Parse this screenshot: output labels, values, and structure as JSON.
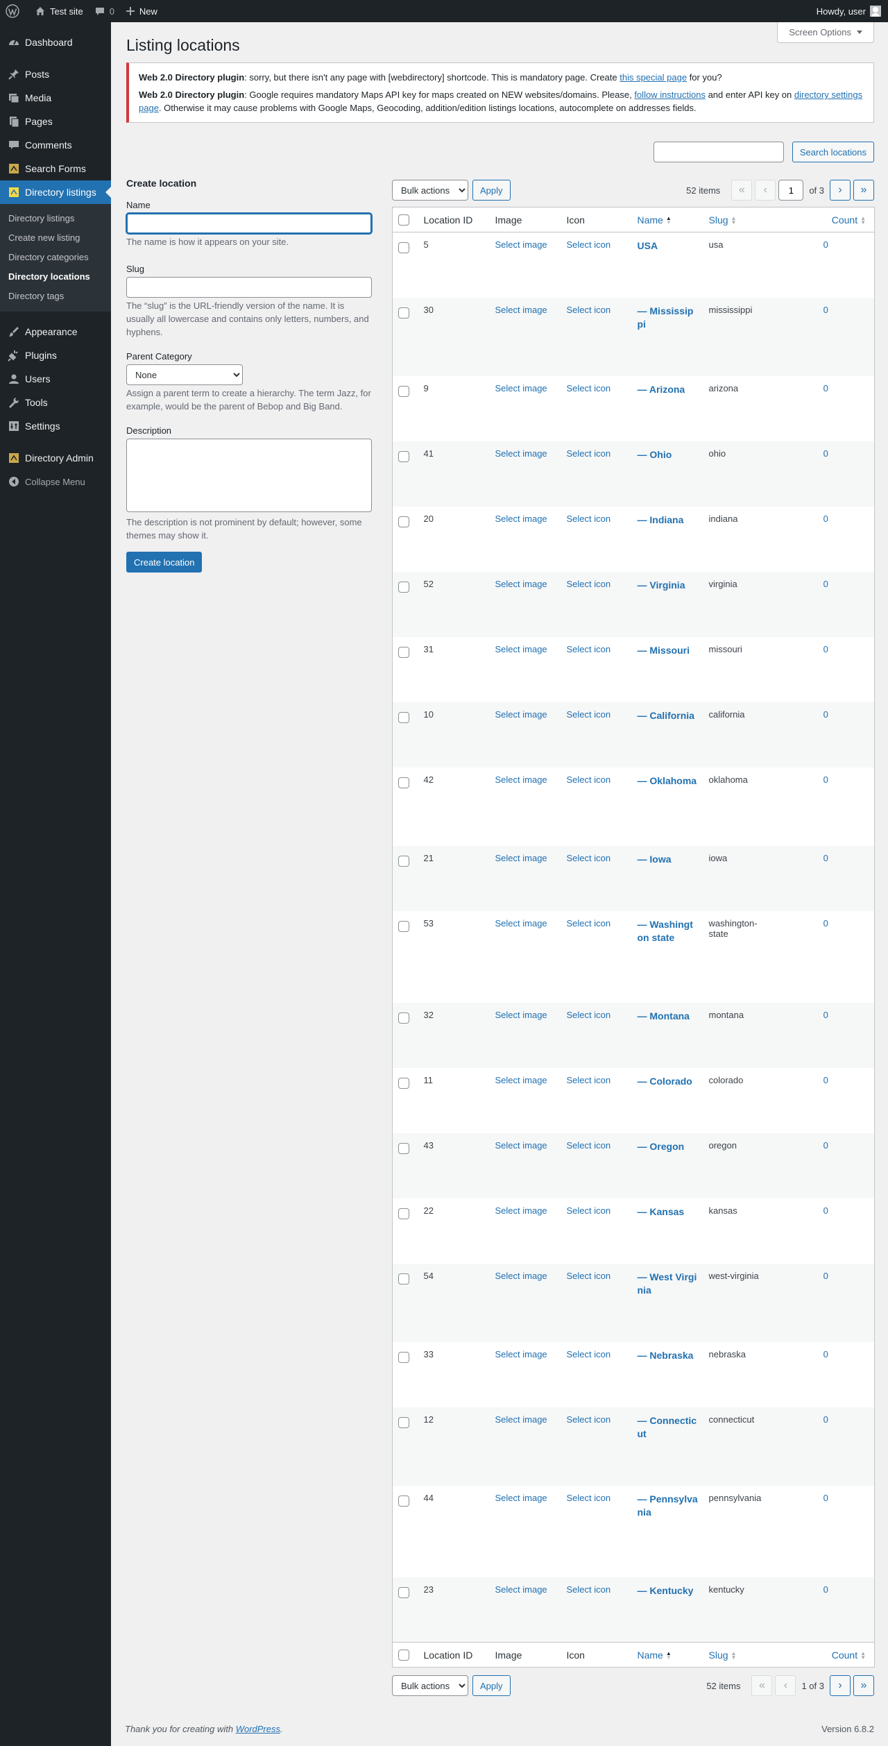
{
  "adminbar": {
    "site_name": "Test site",
    "comments_count": "0",
    "new_label": "New",
    "howdy": "Howdy, user"
  },
  "sidebar": {
    "items": [
      {
        "label": "Dashboard",
        "icon": "dashboard-icon"
      },
      {
        "label": "Posts",
        "icon": "pin-icon"
      },
      {
        "label": "Media",
        "icon": "media-icon"
      },
      {
        "label": "Pages",
        "icon": "pages-icon"
      },
      {
        "label": "Comments",
        "icon": "comment-icon"
      },
      {
        "label": "Search Forms",
        "icon": "plugin-box-icon"
      },
      {
        "label": "Directory listings",
        "icon": "plugin-box-icon"
      }
    ],
    "submenu": [
      "Directory listings",
      "Create new listing",
      "Directory categories",
      "Directory locations",
      "Directory tags"
    ],
    "items2": [
      {
        "label": "Appearance",
        "icon": "brush-icon"
      },
      {
        "label": "Plugins",
        "icon": "plug-icon"
      },
      {
        "label": "Users",
        "icon": "users-icon"
      },
      {
        "label": "Tools",
        "icon": "wrench-icon"
      },
      {
        "label": "Settings",
        "icon": "settings-icon"
      }
    ],
    "directory_admin": "Directory Admin",
    "collapse": "Collapse Menu"
  },
  "page": {
    "title": "Listing locations",
    "screen_options": "Screen Options"
  },
  "notice": {
    "plugin": "Web 2.0 Directory plugin",
    "msg1_a": ": sorry, but there isn't any page with [webdirectory] shortcode. This is mandatory page. Create ",
    "msg1_link": "this special page",
    "msg1_b": " for you?",
    "msg2_a": ": Google requires mandatory Maps API key for maps created on NEW websites/domains. Please, ",
    "msg2_link1": "follow instructions",
    "msg2_b": " and enter API key on ",
    "msg2_link2": "directory settings page",
    "msg2_c": ". Otherwise it may cause problems with Google Maps, Geocoding, addition/edition listings locations, autocomplete on addresses fields."
  },
  "search": {
    "button": "Search locations",
    "value": ""
  },
  "form": {
    "heading": "Create location",
    "name_label": "Name",
    "name_desc": "The name is how it appears on your site.",
    "slug_label": "Slug",
    "slug_desc": "The “slug” is the URL-friendly version of the name. It is usually all lowercase and contains only letters, numbers, and hyphens.",
    "parent_label": "Parent Category",
    "parent_value": "None",
    "parent_desc": "Assign a parent term to create a hierarchy. The term Jazz, for example, would be the parent of Bebop and Big Band.",
    "description_label": "Description",
    "description_desc": "The description is not prominent by default; however, some themes may show it.",
    "submit": "Create location"
  },
  "tablenav": {
    "bulk_actions": "Bulk actions",
    "apply": "Apply",
    "items": "52 items",
    "current_page": "1",
    "of_pages": "of 3",
    "bottom_page_text": "1 of 3"
  },
  "table": {
    "columns": [
      "Location ID",
      "Image",
      "Icon",
      "Name",
      "Slug",
      "Count"
    ],
    "select_image": "Select image",
    "select_icon": "Select icon",
    "rows": [
      {
        "id": "5",
        "name": "USA",
        "slug": "usa",
        "count": "0"
      },
      {
        "id": "30",
        "name": "— Mississippi",
        "slug": "mississippi",
        "count": "0"
      },
      {
        "id": "9",
        "name": "— Arizona",
        "slug": "arizona",
        "count": "0"
      },
      {
        "id": "41",
        "name": "— Ohio",
        "slug": "ohio",
        "count": "0"
      },
      {
        "id": "20",
        "name": "— Indiana",
        "slug": "indiana",
        "count": "0"
      },
      {
        "id": "52",
        "name": "— Virginia",
        "slug": "virginia",
        "count": "0"
      },
      {
        "id": "31",
        "name": "— Missouri",
        "slug": "missouri",
        "count": "0"
      },
      {
        "id": "10",
        "name": "— California",
        "slug": "california",
        "count": "0"
      },
      {
        "id": "42",
        "name": "— Oklahoma",
        "slug": "oklahoma",
        "count": "0"
      },
      {
        "id": "21",
        "name": "— Iowa",
        "slug": "iowa",
        "count": "0"
      },
      {
        "id": "53",
        "name": "— Washington state",
        "slug": "washington-state",
        "count": "0"
      },
      {
        "id": "32",
        "name": "— Montana",
        "slug": "montana",
        "count": "0"
      },
      {
        "id": "11",
        "name": "— Colorado",
        "slug": "colorado",
        "count": "0"
      },
      {
        "id": "43",
        "name": "— Oregon",
        "slug": "oregon",
        "count": "0"
      },
      {
        "id": "22",
        "name": "— Kansas",
        "slug": "kansas",
        "count": "0"
      },
      {
        "id": "54",
        "name": "— West Virginia",
        "slug": "west-virginia",
        "count": "0"
      },
      {
        "id": "33",
        "name": "— Nebraska",
        "slug": "nebraska",
        "count": "0"
      },
      {
        "id": "12",
        "name": "— Connecticut",
        "slug": "connecticut",
        "count": "0"
      },
      {
        "id": "44",
        "name": "— Pennsylvania",
        "slug": "pennsylvania",
        "count": "0"
      },
      {
        "id": "23",
        "name": "— Kentucky",
        "slug": "kentucky",
        "count": "0"
      }
    ]
  },
  "footer": {
    "thanks_a": "Thank you for creating with ",
    "thanks_link": "WordPress",
    "thanks_b": ".",
    "version": "Version 6.8.2"
  },
  "colors": {
    "accent": "#2271b1",
    "sidebar": "#1d2327",
    "notice_error": "#d63638"
  }
}
